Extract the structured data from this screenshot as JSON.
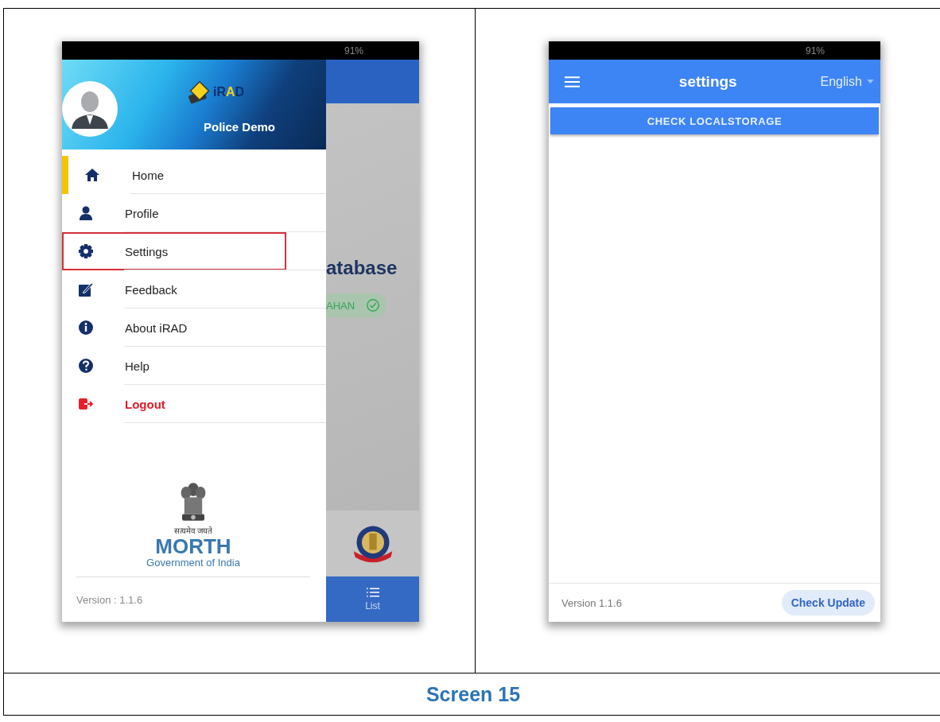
{
  "drawer_screen": {
    "status_bar": {
      "battery": "91%"
    },
    "header": {
      "logo_text": "iRAD",
      "user_name": "Police Demo"
    },
    "menu": [
      {
        "kind": "home",
        "label": "Home",
        "selected": true,
        "highlighted": false
      },
      {
        "kind": "profile",
        "label": "Profile",
        "selected": false,
        "highlighted": false
      },
      {
        "kind": "settings",
        "label": "Settings",
        "selected": false,
        "highlighted": true
      },
      {
        "kind": "feedback",
        "label": "Feedback",
        "selected": false,
        "highlighted": false
      },
      {
        "kind": "about",
        "label": "About iRAD",
        "selected": false,
        "highlighted": false
      },
      {
        "kind": "help",
        "label": "Help",
        "selected": false,
        "highlighted": false
      },
      {
        "kind": "logout",
        "label": "Logout",
        "selected": false,
        "highlighted": false
      }
    ],
    "emblem": {
      "motto": "सत्यमेव जयते",
      "title": "MORTH",
      "subtitle": "Government of India"
    },
    "version": "Version : 1.1.6",
    "background_page": {
      "heading": "atabase",
      "badge": "AHAN",
      "tab": "List"
    }
  },
  "settings_screen": {
    "status_bar": {
      "battery": "91%"
    },
    "app_bar": {
      "title": "settings",
      "language": "English"
    },
    "button": "CHECK LOCALSTORAGE",
    "version": "Version 1.1.6",
    "update_button": "Check Update"
  },
  "caption": "Screen 15"
}
